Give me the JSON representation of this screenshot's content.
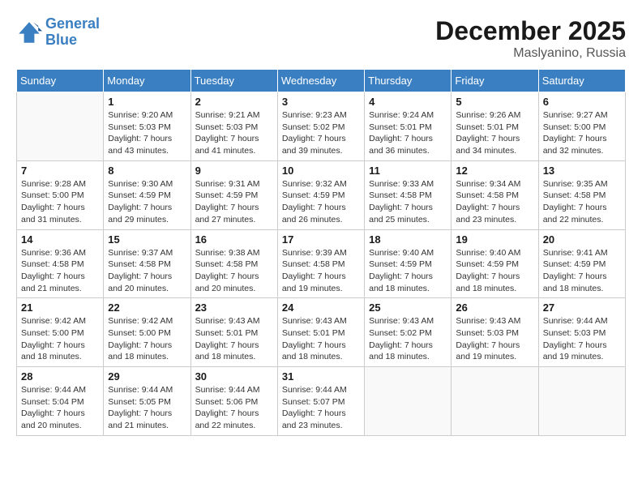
{
  "header": {
    "logo_line1": "General",
    "logo_line2": "Blue",
    "month": "December 2025",
    "location": "Maslyanino, Russia"
  },
  "weekdays": [
    "Sunday",
    "Monday",
    "Tuesday",
    "Wednesday",
    "Thursday",
    "Friday",
    "Saturday"
  ],
  "weeks": [
    [
      {
        "day": "",
        "info": ""
      },
      {
        "day": "1",
        "info": "Sunrise: 9:20 AM\nSunset: 5:03 PM\nDaylight: 7 hours\nand 43 minutes."
      },
      {
        "day": "2",
        "info": "Sunrise: 9:21 AM\nSunset: 5:03 PM\nDaylight: 7 hours\nand 41 minutes."
      },
      {
        "day": "3",
        "info": "Sunrise: 9:23 AM\nSunset: 5:02 PM\nDaylight: 7 hours\nand 39 minutes."
      },
      {
        "day": "4",
        "info": "Sunrise: 9:24 AM\nSunset: 5:01 PM\nDaylight: 7 hours\nand 36 minutes."
      },
      {
        "day": "5",
        "info": "Sunrise: 9:26 AM\nSunset: 5:01 PM\nDaylight: 7 hours\nand 34 minutes."
      },
      {
        "day": "6",
        "info": "Sunrise: 9:27 AM\nSunset: 5:00 PM\nDaylight: 7 hours\nand 32 minutes."
      }
    ],
    [
      {
        "day": "7",
        "info": "Sunrise: 9:28 AM\nSunset: 5:00 PM\nDaylight: 7 hours\nand 31 minutes."
      },
      {
        "day": "8",
        "info": "Sunrise: 9:30 AM\nSunset: 4:59 PM\nDaylight: 7 hours\nand 29 minutes."
      },
      {
        "day": "9",
        "info": "Sunrise: 9:31 AM\nSunset: 4:59 PM\nDaylight: 7 hours\nand 27 minutes."
      },
      {
        "day": "10",
        "info": "Sunrise: 9:32 AM\nSunset: 4:59 PM\nDaylight: 7 hours\nand 26 minutes."
      },
      {
        "day": "11",
        "info": "Sunrise: 9:33 AM\nSunset: 4:58 PM\nDaylight: 7 hours\nand 25 minutes."
      },
      {
        "day": "12",
        "info": "Sunrise: 9:34 AM\nSunset: 4:58 PM\nDaylight: 7 hours\nand 23 minutes."
      },
      {
        "day": "13",
        "info": "Sunrise: 9:35 AM\nSunset: 4:58 PM\nDaylight: 7 hours\nand 22 minutes."
      }
    ],
    [
      {
        "day": "14",
        "info": "Sunrise: 9:36 AM\nSunset: 4:58 PM\nDaylight: 7 hours\nand 21 minutes."
      },
      {
        "day": "15",
        "info": "Sunrise: 9:37 AM\nSunset: 4:58 PM\nDaylight: 7 hours\nand 20 minutes."
      },
      {
        "day": "16",
        "info": "Sunrise: 9:38 AM\nSunset: 4:58 PM\nDaylight: 7 hours\nand 20 minutes."
      },
      {
        "day": "17",
        "info": "Sunrise: 9:39 AM\nSunset: 4:58 PM\nDaylight: 7 hours\nand 19 minutes."
      },
      {
        "day": "18",
        "info": "Sunrise: 9:40 AM\nSunset: 4:59 PM\nDaylight: 7 hours\nand 18 minutes."
      },
      {
        "day": "19",
        "info": "Sunrise: 9:40 AM\nSunset: 4:59 PM\nDaylight: 7 hours\nand 18 minutes."
      },
      {
        "day": "20",
        "info": "Sunrise: 9:41 AM\nSunset: 4:59 PM\nDaylight: 7 hours\nand 18 minutes."
      }
    ],
    [
      {
        "day": "21",
        "info": "Sunrise: 9:42 AM\nSunset: 5:00 PM\nDaylight: 7 hours\nand 18 minutes."
      },
      {
        "day": "22",
        "info": "Sunrise: 9:42 AM\nSunset: 5:00 PM\nDaylight: 7 hours\nand 18 minutes."
      },
      {
        "day": "23",
        "info": "Sunrise: 9:43 AM\nSunset: 5:01 PM\nDaylight: 7 hours\nand 18 minutes."
      },
      {
        "day": "24",
        "info": "Sunrise: 9:43 AM\nSunset: 5:01 PM\nDaylight: 7 hours\nand 18 minutes."
      },
      {
        "day": "25",
        "info": "Sunrise: 9:43 AM\nSunset: 5:02 PM\nDaylight: 7 hours\nand 18 minutes."
      },
      {
        "day": "26",
        "info": "Sunrise: 9:43 AM\nSunset: 5:03 PM\nDaylight: 7 hours\nand 19 minutes."
      },
      {
        "day": "27",
        "info": "Sunrise: 9:44 AM\nSunset: 5:03 PM\nDaylight: 7 hours\nand 19 minutes."
      }
    ],
    [
      {
        "day": "28",
        "info": "Sunrise: 9:44 AM\nSunset: 5:04 PM\nDaylight: 7 hours\nand 20 minutes."
      },
      {
        "day": "29",
        "info": "Sunrise: 9:44 AM\nSunset: 5:05 PM\nDaylight: 7 hours\nand 21 minutes."
      },
      {
        "day": "30",
        "info": "Sunrise: 9:44 AM\nSunset: 5:06 PM\nDaylight: 7 hours\nand 22 minutes."
      },
      {
        "day": "31",
        "info": "Sunrise: 9:44 AM\nSunset: 5:07 PM\nDaylight: 7 hours\nand 23 minutes."
      },
      {
        "day": "",
        "info": ""
      },
      {
        "day": "",
        "info": ""
      },
      {
        "day": "",
        "info": ""
      }
    ]
  ]
}
